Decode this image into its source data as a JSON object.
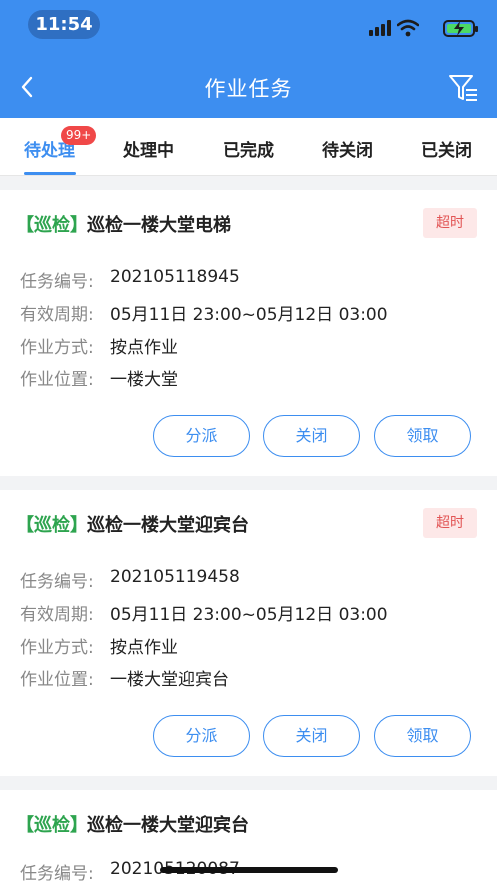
{
  "status_bar": {
    "time": "11:54"
  },
  "nav": {
    "title": "作业任务"
  },
  "tabs": [
    {
      "label": "待处理",
      "badge": "99+"
    },
    {
      "label": "处理中"
    },
    {
      "label": "已完成"
    },
    {
      "label": "待关闭"
    },
    {
      "label": "已关闭"
    }
  ],
  "labels": {
    "task_no": "任务编号:",
    "period": "有效周期:",
    "method": "作业方式:",
    "location": "作业位置:",
    "dispatch": "分派",
    "close": "关闭",
    "claim": "领取"
  },
  "tasks": [
    {
      "tag": "【巡检】",
      "title": "巡检一楼大堂电梯",
      "status": "超时",
      "task_no": "202105118945",
      "period": "05月11日 23:00~05月12日 03:00",
      "method": "按点作业",
      "location": "一楼大堂"
    },
    {
      "tag": "【巡检】",
      "title": "巡检一楼大堂迎宾台",
      "status": "超时",
      "task_no": "202105119458",
      "period": "05月11日 23:00~05月12日 03:00",
      "method": "按点作业",
      "location": "一楼大堂迎宾台"
    },
    {
      "tag": "【巡检】",
      "title": "巡检一楼大堂迎宾台",
      "task_no": "202105120087"
    }
  ]
}
